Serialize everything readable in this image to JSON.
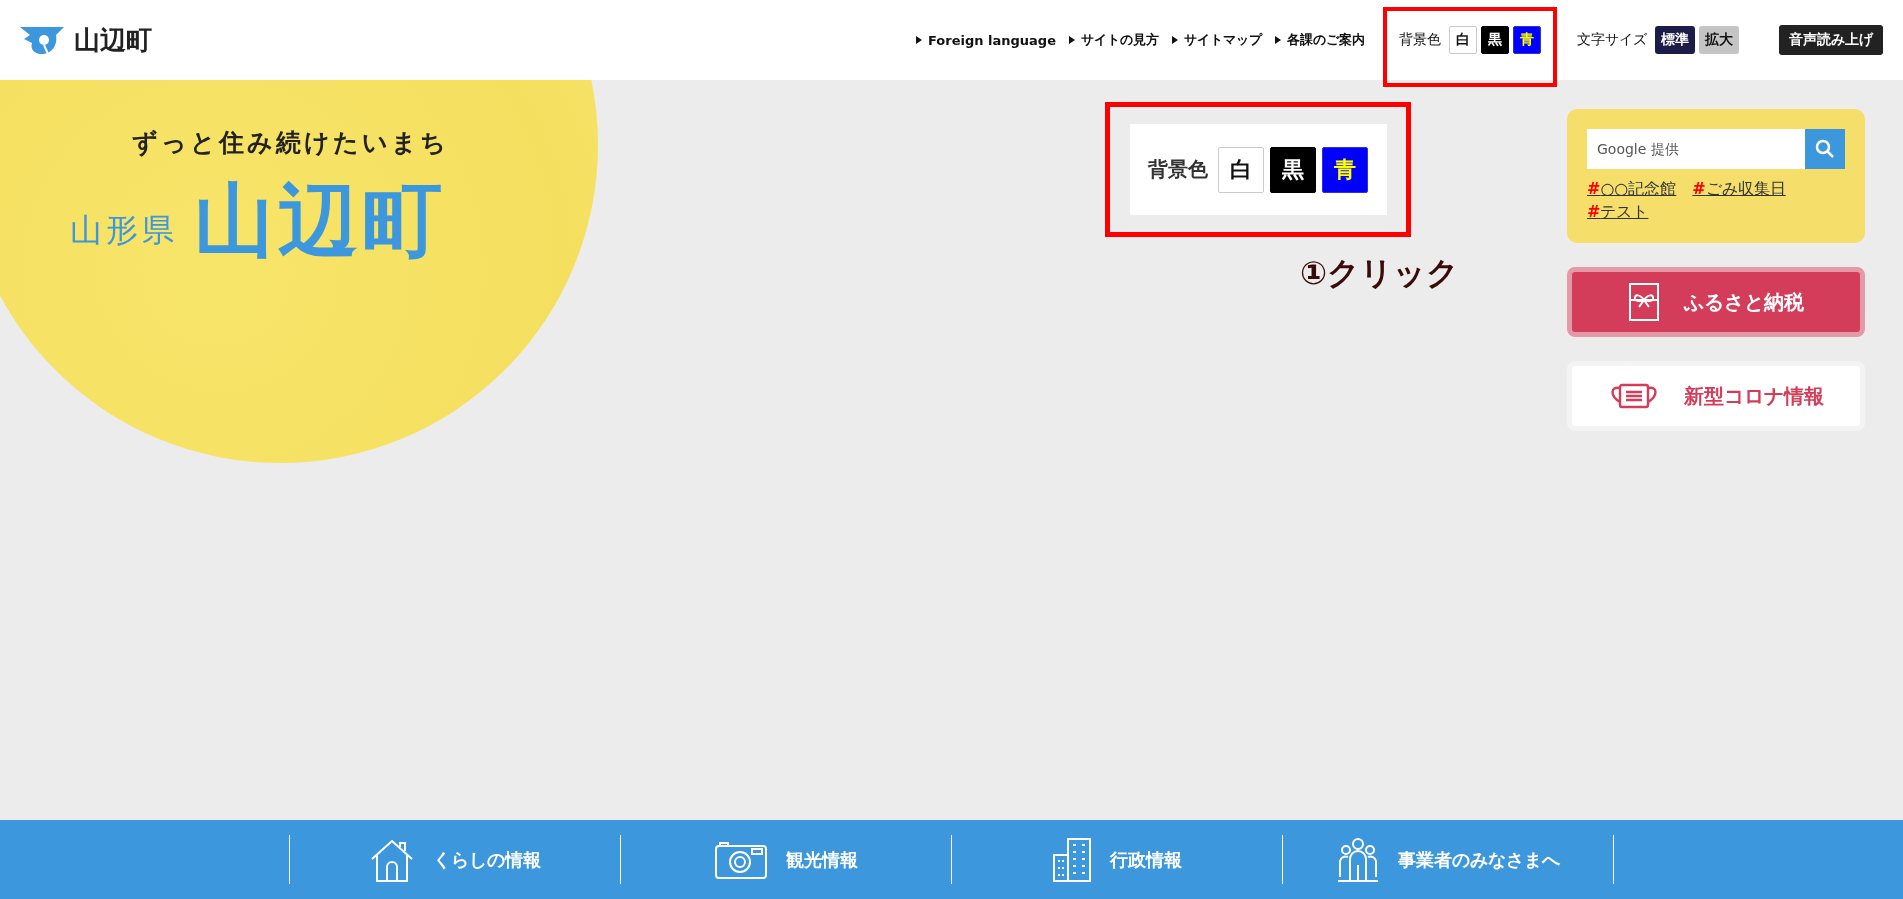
{
  "header": {
    "logo_text": "山辺町",
    "nav_links": [
      "Foreign language",
      "サイトの見方",
      "サイトマップ",
      "各課のご案内"
    ],
    "background_color": {
      "label": "背景色",
      "options": [
        {
          "label": "白",
          "kind": "white"
        },
        {
          "label": "黒",
          "kind": "black"
        },
        {
          "label": "青",
          "kind": "blue"
        }
      ]
    },
    "font_size": {
      "label": "文字サイズ",
      "options": [
        {
          "label": "標準",
          "selected": true
        },
        {
          "label": "拡大",
          "selected": false
        }
      ]
    },
    "speech_button": "音声読み上げ"
  },
  "hero": {
    "tagline": "ずっと住み続けたいまち",
    "prefecture": "山形県",
    "town": "山辺町"
  },
  "annotation": {
    "label": "背景色",
    "options": [
      {
        "label": "白",
        "kind": "white"
      },
      {
        "label": "黒",
        "kind": "black"
      },
      {
        "label": "青",
        "kind": "blue"
      }
    ],
    "step": "①クリック"
  },
  "sidebar": {
    "search": {
      "placeholder": "Google 提供"
    },
    "tags": [
      {
        "mark": "#",
        "label": "○○記念館"
      },
      {
        "mark": "#",
        "label": "ごみ収集日"
      },
      {
        "mark": "#",
        "label": "テスト"
      }
    ],
    "buttons": [
      {
        "label": "ふるさと納税",
        "kind": "gift"
      },
      {
        "label": "新型コロナ情報",
        "kind": "mask"
      }
    ]
  },
  "footer_nav": [
    {
      "label": "くらしの情報",
      "kind": "house"
    },
    {
      "label": "観光情報",
      "kind": "camera"
    },
    {
      "label": "行政情報",
      "kind": "building"
    },
    {
      "label": "事業者のみなさまへ",
      "kind": "people"
    }
  ]
}
